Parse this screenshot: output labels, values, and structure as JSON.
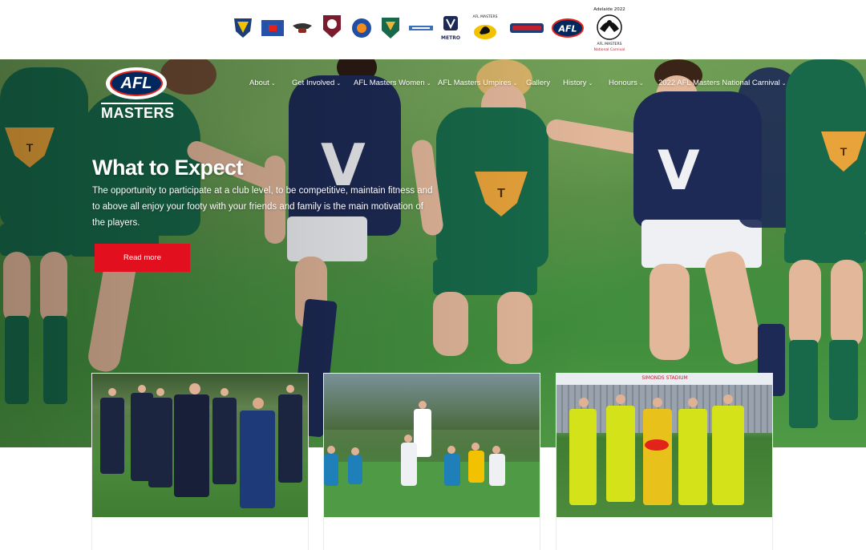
{
  "logos": [
    {
      "name": "afl-masters-crest-logo",
      "color": "#1d3d7a",
      "accent": "#f2c200"
    },
    {
      "name": "state-flag-logo",
      "color": "#2551a8",
      "accent": "#e2231a"
    },
    {
      "name": "winged-club-logo",
      "color": "#8a2b22",
      "accent": "#333333"
    },
    {
      "name": "maroon-shield-logo",
      "color": "#7b1c2e",
      "accent": "#ffffff"
    },
    {
      "name": "blue-orange-crest-logo",
      "color": "#1f4ea3",
      "accent": "#f28c1d"
    },
    {
      "name": "green-gold-shield-logo",
      "color": "#17694a",
      "accent": "#e8b43a"
    },
    {
      "name": "small-text-logo",
      "color": "#3a6fbf",
      "accent": "#1a1a1a"
    },
    {
      "name": "vic-metro-logo",
      "color": "#1d2a55",
      "text": "METRO"
    },
    {
      "name": "black-swan-logo",
      "color": "#111111",
      "accent": "#f2c200",
      "text": "AFL MASTERS"
    },
    {
      "name": "script-wordmark-logo",
      "color": "#c21f2d",
      "accent": "#1d3d7a"
    },
    {
      "name": "afl-oval-logo",
      "color": "#01285e",
      "text": "AFL"
    },
    {
      "name": "adelaide-2022-carnival-logo",
      "color": "#111111",
      "text_top": "Adelaide 2022",
      "text_bottom": "AFL MASTERS National Carnival"
    }
  ],
  "site": {
    "logo_top": "AFL",
    "logo_bottom": "MASTERS"
  },
  "nav": [
    {
      "label": "About"
    },
    {
      "label": "Get Involved"
    },
    {
      "label": "AFL Masters Women"
    },
    {
      "label": "AFL Masters Umpires"
    },
    {
      "label": "Gallery"
    },
    {
      "label": "History"
    },
    {
      "label": "Honours"
    },
    {
      "label": "2022 AFL Masters National Carnival"
    }
  ],
  "hero": {
    "title": "What to Expect",
    "text": "The opportunity to participate at a club level, to be competitive, maintain fitness and to above all enjoy your footy with your friends and family is the main motivation of the players.",
    "button": "Read more",
    "button_color": "#e2101e"
  },
  "cards": [
    {
      "name": "team-photo-card",
      "scene": "group of players walking in navy kit"
    },
    {
      "name": "match-photo-card",
      "scene": "players contesting a ball up"
    },
    {
      "name": "umpires-photo-card",
      "scene": "umpires lined up at Simonds Stadium",
      "banner": "SIMONDS STADIUM"
    }
  ]
}
